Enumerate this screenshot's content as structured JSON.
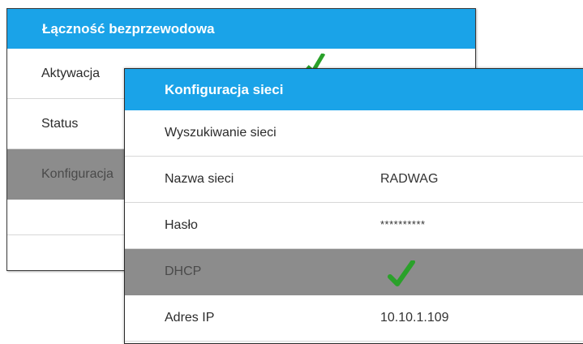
{
  "wireless_panel": {
    "title": "Łączność bezprzewodowa",
    "items": [
      {
        "label": "Aktywacja",
        "checked": true
      },
      {
        "label": "Status"
      },
      {
        "label": "Konfiguracja",
        "selected": true
      },
      {
        "label": ""
      },
      {
        "label": ""
      }
    ]
  },
  "network_panel": {
    "title": "Konfiguracja sieci",
    "items": [
      {
        "label": "Wyszukiwanie sieci",
        "value": ""
      },
      {
        "label": "Nazwa sieci",
        "value": "RADWAG"
      },
      {
        "label": "Hasło",
        "value": "**********"
      },
      {
        "label": "DHCP",
        "checked": true,
        "selected": true
      },
      {
        "label": "Adres IP",
        "value": "10.10.1.109"
      }
    ]
  },
  "colors": {
    "header": "#1aa3e8",
    "selected_row": "#8c8c8c",
    "check": "#2aa12a"
  },
  "icons": {
    "check": "check-icon"
  }
}
